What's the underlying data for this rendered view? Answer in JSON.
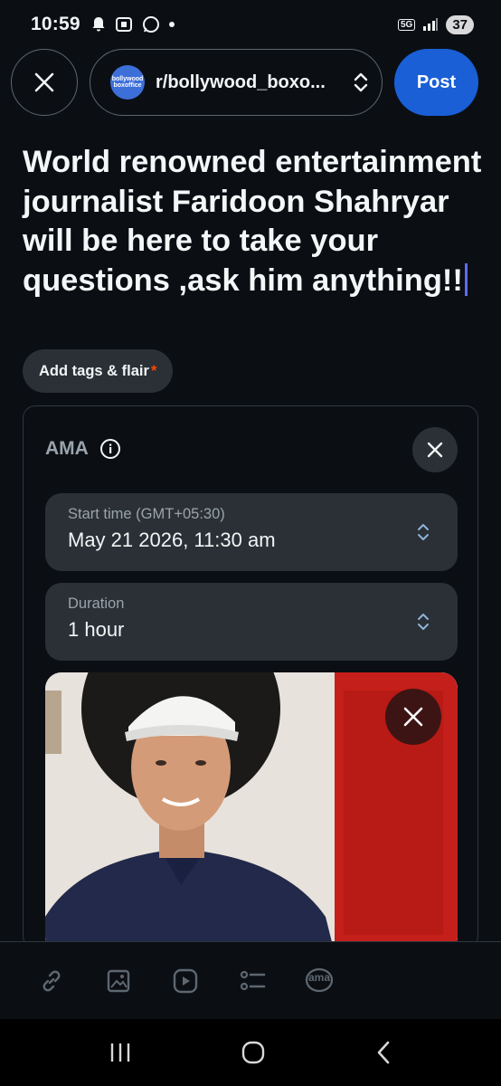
{
  "status_bar": {
    "time": "10:59",
    "network": "5G",
    "battery": "37"
  },
  "header": {
    "community_name": "r/bollywood_boxo...",
    "community_avatar_text": "bollywood boxoffice",
    "post_label": "Post"
  },
  "post": {
    "title": "World renowned entertainment journalist Faridoon Shahryar will be here to take your questions ,ask him anything!!",
    "tags_label": "Add tags & flair",
    "required_mark": "*"
  },
  "ama": {
    "title": "AMA",
    "start_time_label": "Start time (GMT+05:30)",
    "start_time_value": "May 21 2026, 11:30 am",
    "duration_label": "Duration",
    "duration_value": "1 hour"
  },
  "toolbar": {
    "ama_icon_text": "ama"
  },
  "colors": {
    "accent": "#1a5fd6",
    "background": "#0b0f14",
    "field": "#2a3036",
    "required": "#ff4500"
  },
  "icons": [
    "bell-icon",
    "screenshot-icon",
    "whatsapp-icon",
    "close-icon",
    "chevron-updown-icon",
    "info-icon",
    "link-icon",
    "image-icon",
    "video-icon",
    "list-icon",
    "ama-icon",
    "recents-icon",
    "home-icon",
    "back-icon"
  ]
}
